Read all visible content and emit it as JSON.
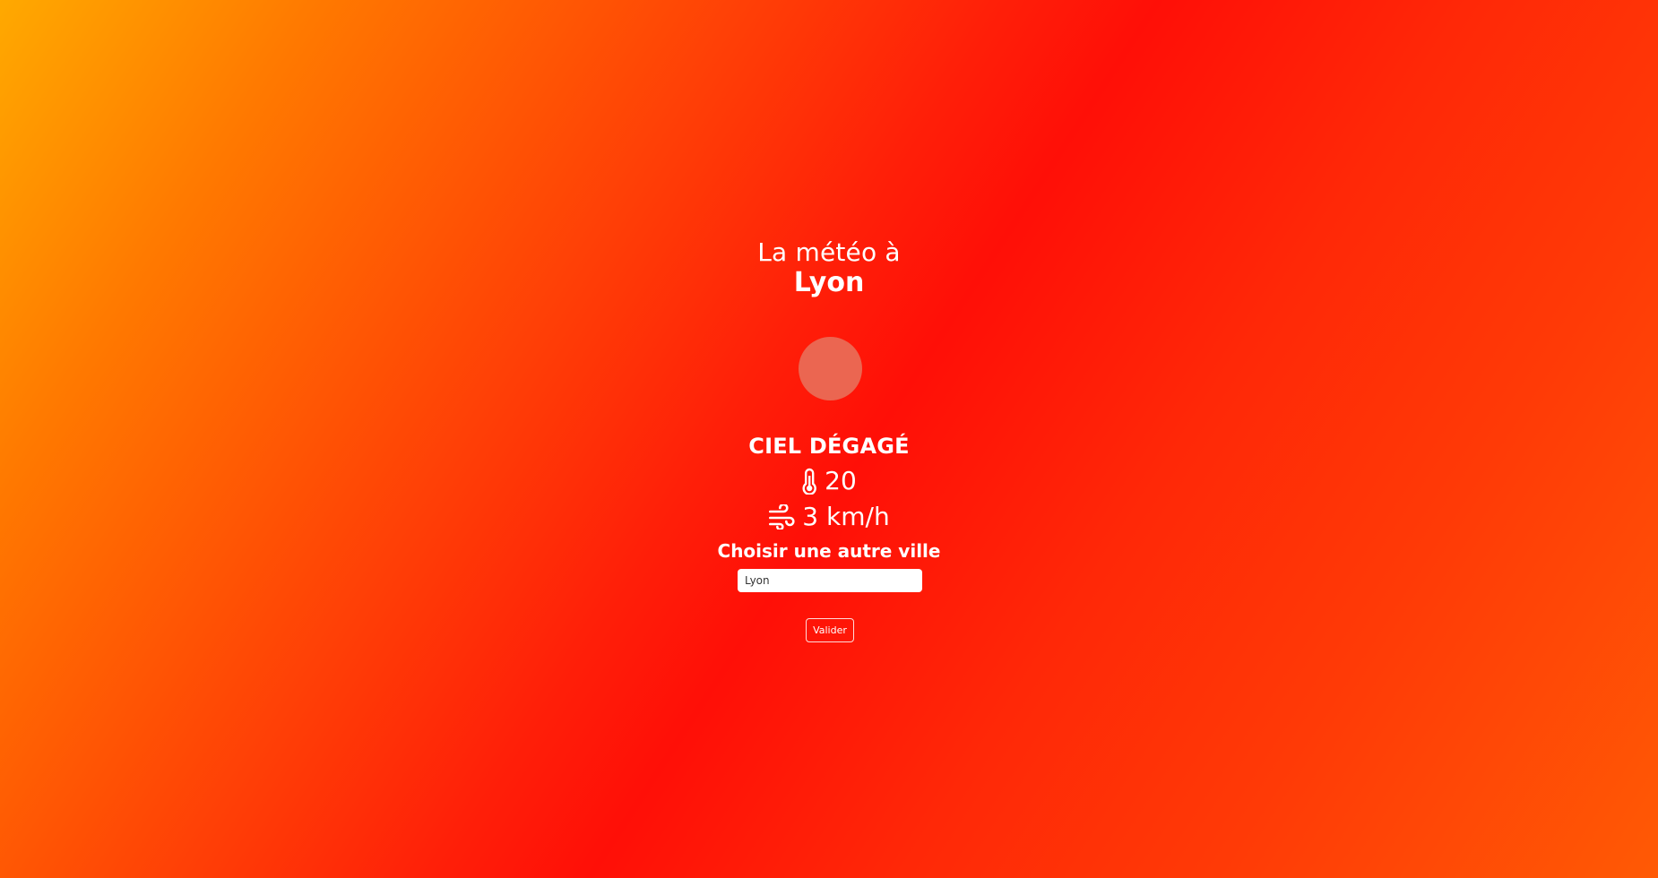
{
  "header": {
    "title_line": "La météo à",
    "city": "Lyon"
  },
  "weather": {
    "description": "CIEL DÉGAGÉ",
    "temperature": "20",
    "wind": "3 km/h",
    "icon": "weather-icon",
    "icon_color": "#ea6a55"
  },
  "form": {
    "title": "Choisir une autre ville",
    "input_value": "Lyon",
    "submit_label": "Valider"
  },
  "theme": {
    "gradient_colors": [
      "#ffa900",
      "#ff4a05",
      "#ff0f07",
      "#ff5a05"
    ],
    "text_color": "#ffffff"
  },
  "icons": {
    "temperature": "thermometer-icon",
    "wind": "wind-icon"
  }
}
